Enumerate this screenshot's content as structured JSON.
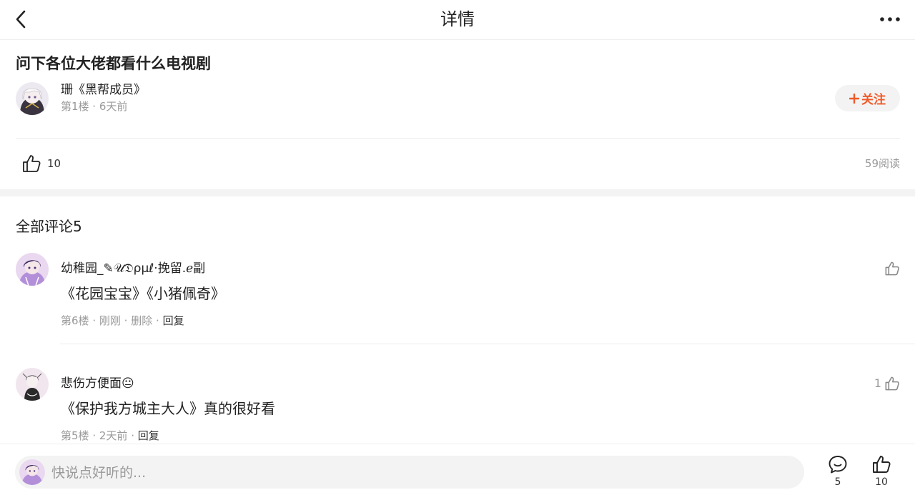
{
  "header": {
    "title": "详情",
    "back_icon": "chevron-left-icon",
    "more_icon": "more-horizontal-icon"
  },
  "post": {
    "title": "问下各位大佬都看什么电视剧",
    "author": {
      "name": "珊《黑帮成员》",
      "meta": "第1楼 · 6天前"
    },
    "follow_label": "关注",
    "like_count": "10",
    "read_count": "59阅读"
  },
  "comments_section": {
    "heading": "全部评论5"
  },
  "comments": [
    {
      "name": "幼稚园_✎𝒰𝔇ρμℓ·挽留.ℯ副",
      "text": "《花园宝宝》《小猪佩奇》",
      "floor": "第6楼",
      "time": "刚刚",
      "delete_label": "删除",
      "reply_label": "回复",
      "like_count": ""
    },
    {
      "name": "悲伤方便面😐",
      "text": "《保护我方城主大人》真的很好看",
      "floor": "第5楼",
      "time": "2天前",
      "reply_label": "回复",
      "like_count": "1"
    }
  ],
  "bottom_bar": {
    "input_placeholder": "快说点好听的...",
    "comment_count": "5",
    "like_count": "10"
  },
  "colors": {
    "accent": "#f05a28",
    "muted_text": "#999999",
    "divider": "#ececec",
    "section_gap": "#f3f3f3"
  }
}
